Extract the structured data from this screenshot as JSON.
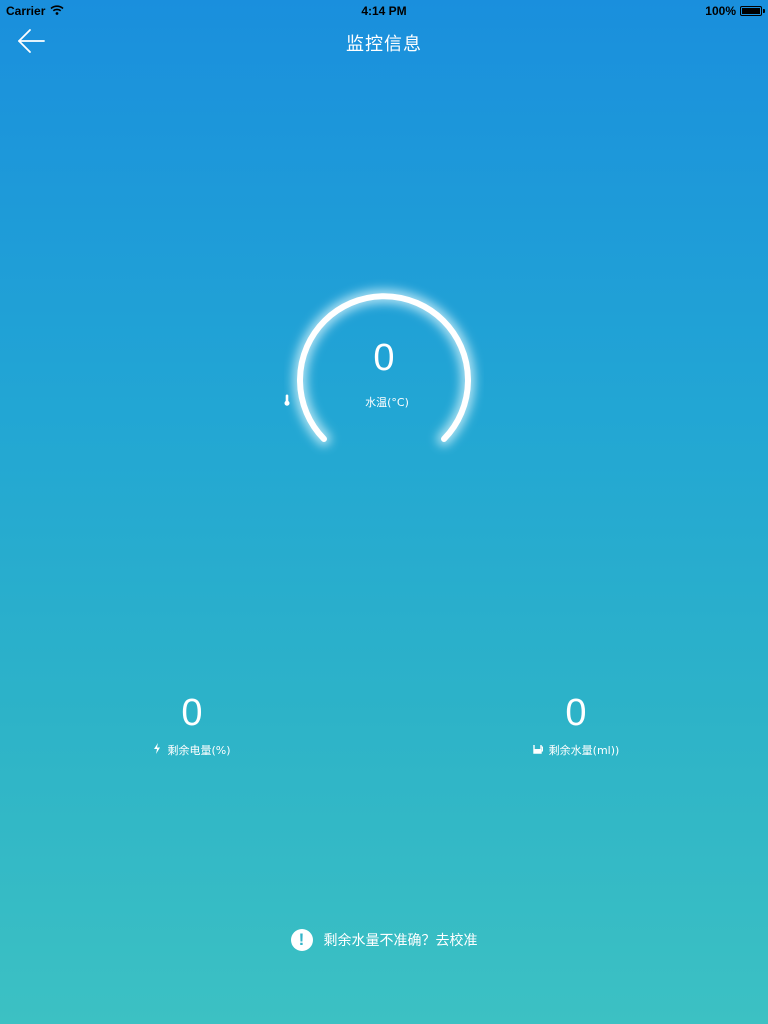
{
  "status_bar": {
    "carrier": "Carrier",
    "time": "4:14 PM",
    "battery": "100%"
  },
  "nav": {
    "title": "监控信息",
    "back_icon": "back-arrow-icon"
  },
  "gauge": {
    "value": "0",
    "label": "水温(°C)",
    "icon": "thermometer-icon"
  },
  "stats": {
    "battery": {
      "value": "0",
      "label": "剩余电量(%)",
      "icon": "lightning-icon"
    },
    "water": {
      "value": "0",
      "label": "剩余水量(ml))",
      "icon": "cup-icon"
    }
  },
  "calibrate": {
    "text": "剩余水量不准确？去校准",
    "icon": "alert-icon"
  },
  "colors": {
    "gradient_top": "#1a8fdd",
    "gradient_bottom": "#3cc1c3",
    "text": "#ffffff"
  }
}
